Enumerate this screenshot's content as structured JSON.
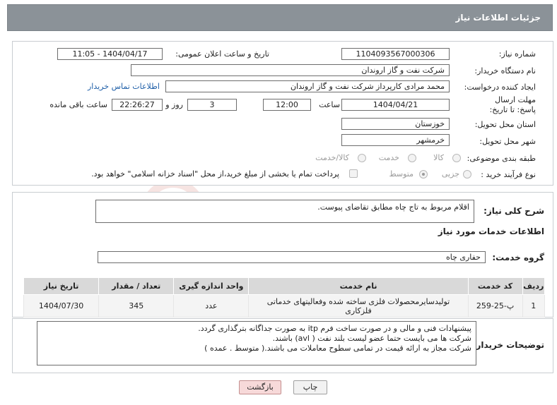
{
  "header": {
    "title": "جزئیات اطلاعات نیاز"
  },
  "form": {
    "need_number_label": "شماره نیاز:",
    "need_number": "1104093567000306",
    "announce_label": "تاریخ و ساعت اعلان عمومی:",
    "announce_value": "1404/04/17 - 11:05",
    "buyer_label": "نام دستگاه خریدار:",
    "buyer_value": "شرکت نفت و گاز اروندان",
    "creator_label": "ایجاد کننده درخواست:",
    "creator_value": "محمد مرادی کارپرداز شرکت نفت و گاز اروندان",
    "contact_link": "اطلاعات تماس خریدار",
    "deadline_label": "مهلت ارسال پاسخ: تا تاریخ:",
    "deadline_date": "1404/04/21",
    "time_label": "ساعت",
    "deadline_time": "12:00",
    "days_value": "3",
    "days_label": "روز و",
    "remaining_time": "22:26:27",
    "remaining_label": "ساعت باقی مانده",
    "province_label": "استان محل تحویل:",
    "province_value": "خوزستان",
    "city_label": "شهر محل تحویل:",
    "city_value": "خرمشهر",
    "category_label": "طبقه بندی موضوعی:",
    "category_options": [
      "کالا",
      "خدمت",
      "کالا/خدمت"
    ],
    "process_label": "نوع فرآیند خرید :",
    "process_options": [
      "جزیی",
      "متوسط"
    ],
    "payment_note": "پرداخت تمام یا بخشی از مبلغ خرید،از محل \"اسناد خزانه اسلامی\" خواهد بود."
  },
  "summary": {
    "label": "شرح کلی نیاز:",
    "value": "اقلام مربوط به تاج چاه مطابق تقاضای پیوست."
  },
  "services": {
    "section_title": "اطلاعات خدمات مورد نیاز",
    "group_label": "گروه خدمت:",
    "group_value": "حفاری چاه",
    "columns": [
      "ردیف",
      "کد خدمت",
      "نام خدمت",
      "واحد اندازه گیری",
      "تعداد / مقدار",
      "تاریخ نیاز"
    ],
    "rows": [
      {
        "index": "1",
        "code": "پ-25-259",
        "name": "تولیدسایرمحصولات فلزی ساخته شده وفعالیتهای خدماتی فلزکاری",
        "unit": "عدد",
        "qty": "345",
        "date": "1404/07/30"
      }
    ]
  },
  "buyer_notes": {
    "label": "توضیحات خریدار:",
    "lines": [
      "پیشنهادات فنی و مالی و در صورت ساخت  فرم itp به صورت جداگانه بترگذاری گردد.",
      "شرکت ها می بایست حتما عضو لیست بلند نفت ( avl) باشند.",
      "شرکت مجاز به ارائه قیمت در تمامی سطوح معاملات می باشند.( متوسط . عمده )"
    ]
  },
  "buttons": {
    "print": "چاپ",
    "back": "بازگشت"
  },
  "colors": {
    "header_bg": "#8b9298",
    "link": "#1f5fa8",
    "back_button_bg": "#f7d9d9"
  },
  "watermark_text": "AriaTender.neT"
}
